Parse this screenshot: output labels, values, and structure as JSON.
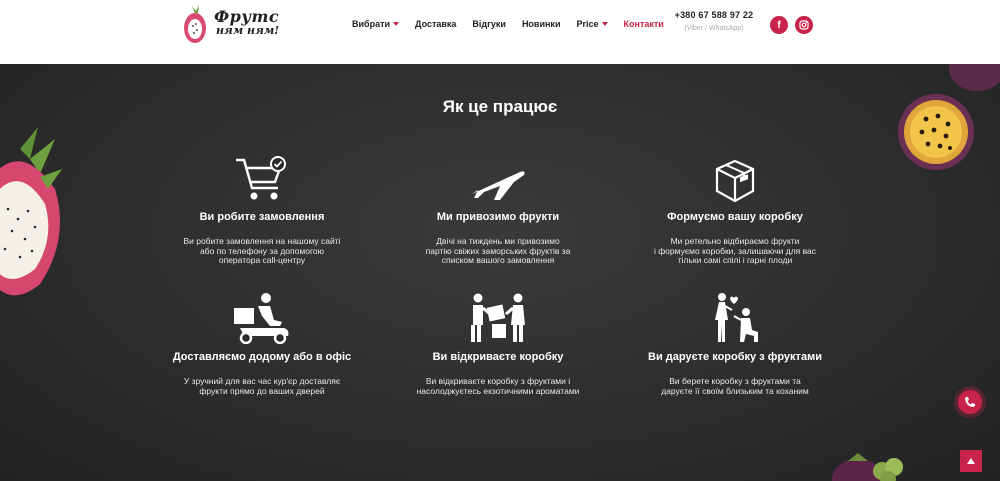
{
  "header": {
    "logo_line1": "Фрутс",
    "logo_line2": "ням ням!",
    "nav": [
      {
        "label": "Вибрати",
        "dropdown": true
      },
      {
        "label": "Доставка",
        "dropdown": false
      },
      {
        "label": "Відгуки",
        "dropdown": false
      },
      {
        "label": "Новинки",
        "dropdown": false
      },
      {
        "label": "Price",
        "dropdown": true
      },
      {
        "label": "Контакти",
        "dropdown": false,
        "active": true
      }
    ],
    "phone": "+380 67 588 97 22",
    "phone_sub": "(Viber / WhatsApp)",
    "social": [
      {
        "icon": "facebook-icon",
        "glyph": "f"
      },
      {
        "icon": "instagram-icon",
        "glyph": "◎"
      }
    ]
  },
  "section": {
    "title": "Як це працює",
    "steps": [
      {
        "icon": "cart-check-icon",
        "title": "Ви робите замовлення",
        "desc": [
          "Ви робите замовлення на нашому сайті",
          "або по телефону за допомогою",
          "оператора call-центру"
        ]
      },
      {
        "icon": "airplane-icon",
        "title": "Ми привозимо фрукти",
        "desc": [
          "Двічі на тиждень ми привозимо",
          "партію свіжих заморських фруктів за",
          "списком вашого замовлення"
        ]
      },
      {
        "icon": "box-icon",
        "title": "Формуємо вашу коробку",
        "desc": [
          "Ми ретельно відбираємо фрукти",
          "і формуємо коробки, залишаючи для вас",
          "тільки самі спілі і гарні плоди"
        ]
      },
      {
        "icon": "courier-scooter-icon",
        "title": "Доставляємо додому або в офіс",
        "desc": [
          "У зручний для вас час кур'єр доставляє",
          "фрукти прямо до ваших дверей"
        ]
      },
      {
        "icon": "people-box-icon",
        "title": "Ви відкриваєте коробку",
        "desc": [
          "Ви відкриваєте коробку з фруктами і",
          "насолоджуєтесь екзотичними ароматами"
        ]
      },
      {
        "icon": "proposal-icon",
        "title": "Ви даруєте коробку з фруктами",
        "desc": [
          "Ви берете коробку з фруктами та",
          "даруєте її своїм близьким та коханим"
        ]
      }
    ]
  },
  "colors": {
    "accent": "#c8234a",
    "dark_bg": "#2b2b2b",
    "header_bg": "#ffffff"
  },
  "floating": {
    "call_icon": "phone-icon",
    "top_icon": "arrow-up-icon"
  }
}
